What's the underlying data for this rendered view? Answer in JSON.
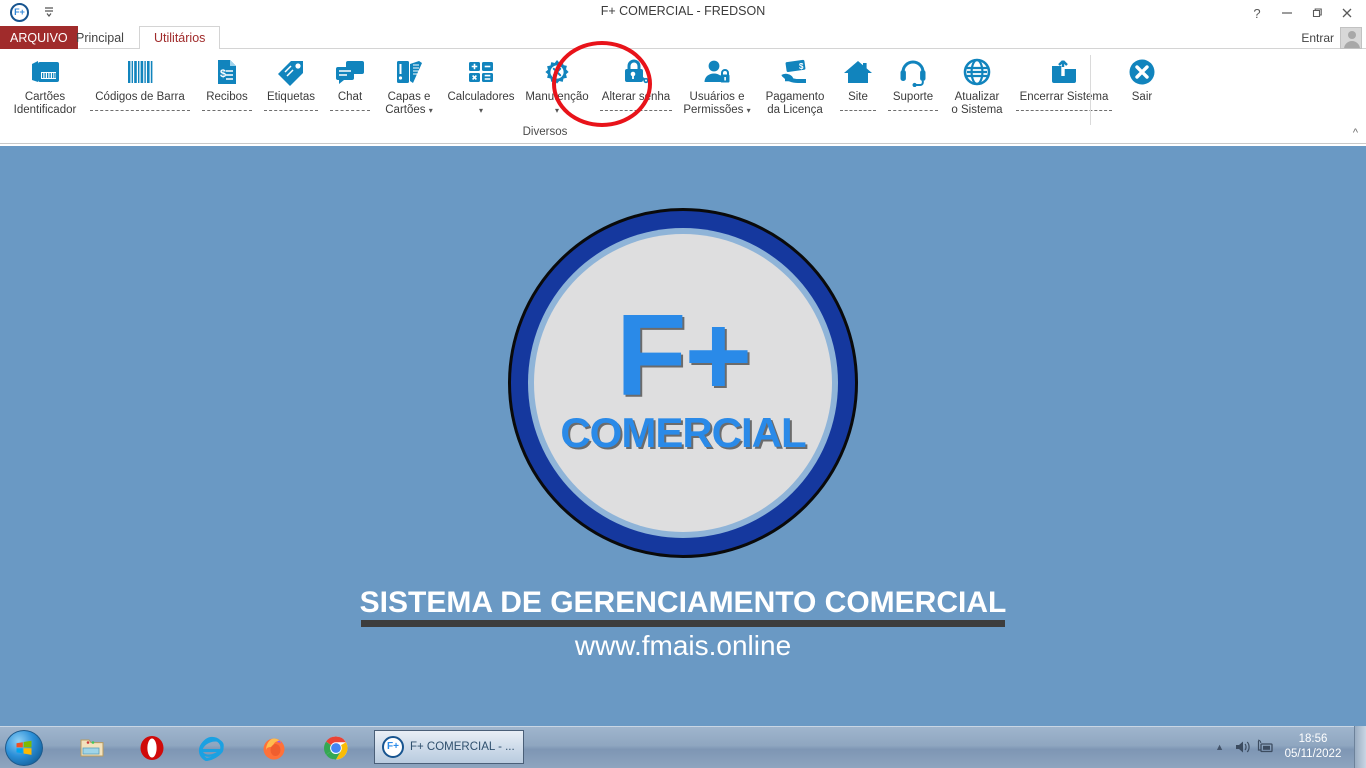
{
  "window": {
    "title": "F+ COMERCIAL - FREDSON",
    "app_badge": "F+",
    "qat_icon": "quick-access-dropdown-icon",
    "help_icon": "?",
    "minimize_icon": "—",
    "maximize_icon": "❐",
    "close_icon": "✕"
  },
  "tabs": {
    "file_label": "ARQUIVO",
    "items": [
      {
        "label": "Principal",
        "active": false
      },
      {
        "label": "Utilitários",
        "active": true
      }
    ]
  },
  "account": {
    "sign_in_label": "Entrar",
    "avatar_icon": "user-avatar-icon"
  },
  "ribbon": {
    "group_label": "Diversos",
    "collapse_icon": "^",
    "items": [
      {
        "icon": "id-card-icon",
        "line1": "Cartões",
        "line2": "Identificador",
        "dashed": false,
        "caret": false
      },
      {
        "icon": "barcode-icon",
        "line1": "Códigos de Barra",
        "line2": "",
        "dashed": true,
        "caret": false
      },
      {
        "icon": "receipt-icon",
        "line1": "Recibos",
        "line2": "",
        "dashed": true,
        "caret": false
      },
      {
        "icon": "tag-icon",
        "line1": "Etiquetas",
        "line2": "",
        "dashed": true,
        "caret": false
      },
      {
        "icon": "chat-icon",
        "line1": "Chat",
        "line2": "",
        "dashed": true,
        "caret": false
      },
      {
        "icon": "folder-cards-icon",
        "line1": "Capas e",
        "line2": "Cartões",
        "dashed": false,
        "caret": true
      },
      {
        "icon": "calculator-icon",
        "line1": "Calculadores",
        "line2": "",
        "dashed": false,
        "caret": true
      },
      {
        "icon": "gear-wrench-icon",
        "line1": "Manutenção",
        "line2": "",
        "dashed": false,
        "caret": true
      },
      {
        "icon": "lock-key-icon",
        "line1": "Alterar senha",
        "line2": "",
        "dashed": true,
        "caret": false
      },
      {
        "icon": "user-lock-icon",
        "line1": "Usuários e",
        "line2": "Permissões",
        "dashed": false,
        "caret": true
      },
      {
        "icon": "money-hand-icon",
        "line1": "Pagamento",
        "line2": "da Licença",
        "dashed": false,
        "caret": false
      },
      {
        "icon": "home-icon",
        "line1": "Site",
        "line2": "",
        "dashed": true,
        "caret": false
      },
      {
        "icon": "headset-icon",
        "line1": "Suporte",
        "line2": "",
        "dashed": true,
        "caret": false
      },
      {
        "icon": "globe-icon",
        "line1": "Atualizar",
        "line2": "o Sistema",
        "dashed": false,
        "caret": false
      },
      {
        "icon": "folder-close-icon",
        "line1": "Encerrar Sistema",
        "line2": "",
        "dashed": true,
        "caret": false
      },
      {
        "icon": "exit-x-icon",
        "line1": "Sair",
        "line2": "",
        "dashed": false,
        "caret": false
      }
    ]
  },
  "annotation": {
    "shape": "red-ellipse-highlight",
    "target": "Alterar senha",
    "color": "#e8131a"
  },
  "desktop": {
    "background_color": "#6a99c4",
    "logo": {
      "mark": "F+",
      "wordmark": "COMERCIAL",
      "ring_color": "#15389e",
      "mark_color": "#2a8ae8"
    },
    "tagline": "SISTEMA DE GERENCIAMENTO COMERCIAL",
    "website": "www.fmais.online"
  },
  "taskbar": {
    "start_icon": "windows-start-orb-icon",
    "pinned": [
      {
        "icon": "file-explorer-icon",
        "name": "file-explorer"
      },
      {
        "icon": "opera-browser-icon",
        "name": "opera"
      },
      {
        "icon": "internet-explorer-icon",
        "name": "internet-explorer"
      },
      {
        "icon": "firefox-browser-icon",
        "name": "firefox"
      },
      {
        "icon": "chrome-browser-icon",
        "name": "chrome"
      }
    ],
    "active_window": {
      "badge": "F+",
      "label": "F+ COMERCIAL - ..."
    },
    "tray": {
      "expand_icon": "▲",
      "volume_icon": "speaker-icon",
      "network_icon": "network-icon",
      "time": "18:56",
      "date": "05/11/2022"
    }
  }
}
